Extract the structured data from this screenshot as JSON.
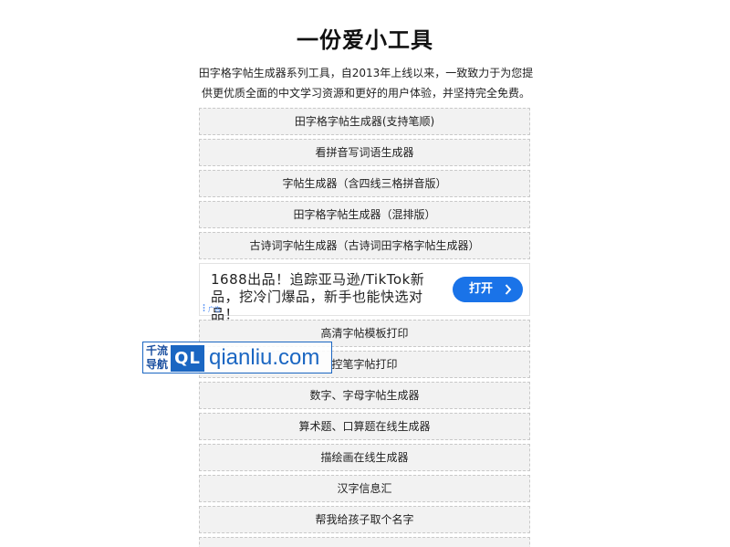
{
  "header": {
    "title": "一份爱小工具",
    "intro": "田字格字帖生成器系列工具，自2013年上线以来，一致致力于为您提供更优质全面的中文学习资源和更好的用户体验，并坚持完全免费。"
  },
  "tools_top": [
    "田字格字帖生成器(支持笔顺)",
    "看拼音写词语生成器",
    "字帖生成器（含四线三格拼音版）",
    "田字格字帖生成器（混排版）",
    "古诗词字帖生成器（古诗词田字格字帖生成器）"
  ],
  "ad": {
    "text": "1688出品！追踪亚马逊/TikTok新品，挖冷门爆品，新手也能快选对品！",
    "button_label": "打开",
    "badge": "广告"
  },
  "tools_bottom": [
    "高清字帖模板打印",
    "控笔字帖打印",
    "数字、字母字帖生成器",
    "算术题、口算题在线生成器",
    "描绘画在线生成器",
    "汉字信息汇",
    "帮我给孩子取个名字"
  ],
  "watermark": {
    "cn_text": "千流导航",
    "logo": "QL",
    "url": "qianliu.com"
  },
  "colors": {
    "accent": "#1a73e8",
    "tool_bg": "#f2f2f2",
    "watermark": "#1a66c2"
  }
}
